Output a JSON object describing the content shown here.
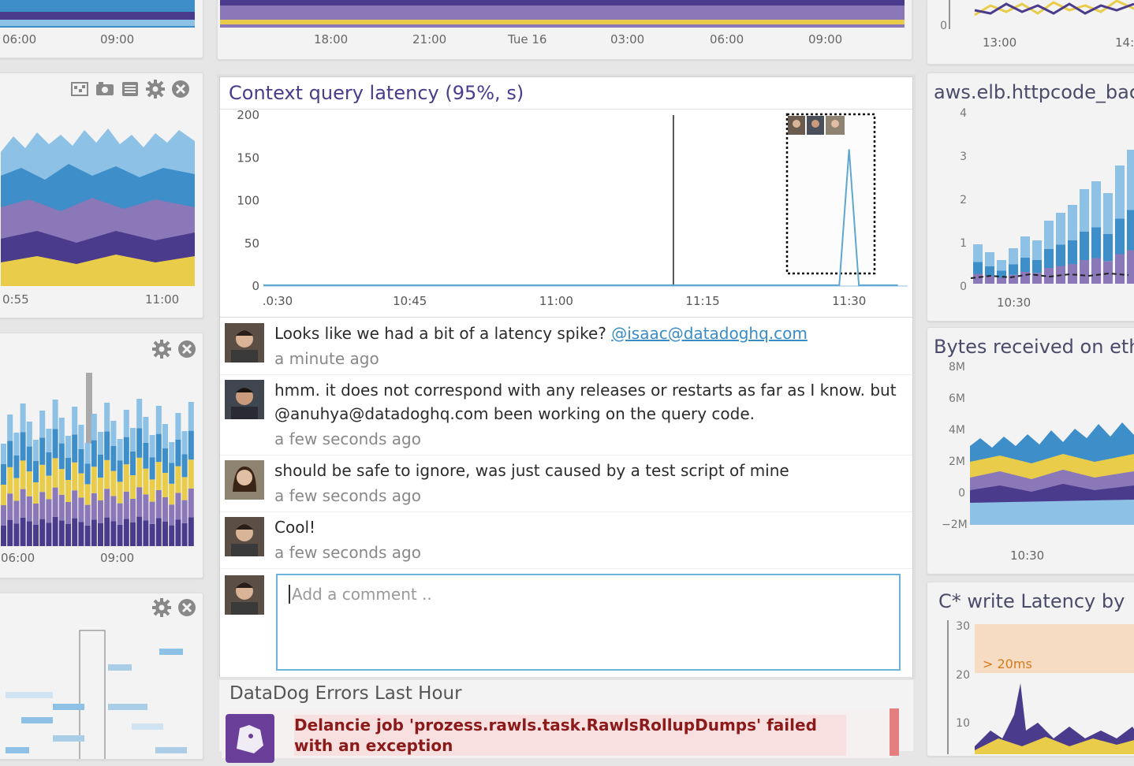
{
  "colors": {
    "purple": "#4b3b8c",
    "blue": "#3d8ec9",
    "light_blue": "#8ec1e6",
    "yellow": "#e9cd4a",
    "lavender": "#8a78b8",
    "line": "#5fa7cf",
    "link": "#3a8cc6",
    "error_red": "#8b1a1a"
  },
  "background_tiles": {
    "top_left": {
      "x_ticks": [
        "06:00",
        "09:00"
      ]
    },
    "top_center": {
      "x_ticks": [
        "18:00",
        "21:00",
        "Tue 16",
        "03:00",
        "06:00",
        "09:00"
      ]
    },
    "top_right": {
      "y_ticks": [
        "0"
      ],
      "x_ticks": [
        "13:00",
        "14:"
      ]
    },
    "left_1": {
      "x_ticks": [
        "0:55",
        "11:00"
      ],
      "icons": [
        "map-icon",
        "camera-icon",
        "list-icon",
        "gear-icon",
        "close-icon"
      ]
    },
    "left_2": {
      "x_ticks": [
        "06:00",
        "09:00"
      ],
      "icons": [
        "gear-icon",
        "close-icon"
      ]
    },
    "left_3": {
      "icons": [
        "gear-icon",
        "close-icon"
      ]
    },
    "right_1": {
      "title": "aws.elb.httpcode_bac",
      "y_ticks": [
        "4",
        "3",
        "2",
        "1",
        "0"
      ],
      "x_ticks": [
        "10:30"
      ]
    },
    "right_2": {
      "title": "Bytes received on eth",
      "y_ticks": [
        "8M",
        "6M",
        "4M",
        "2M",
        "0",
        "−2M"
      ],
      "x_ticks": [
        "10:30"
      ]
    },
    "right_3": {
      "title": "C* write Latency by",
      "y_ticks": [
        "30",
        "20",
        "10"
      ],
      "threshold_label": "> 20ms"
    }
  },
  "focus": {
    "title": "Context query latency (95%, s)",
    "chart_data": {
      "type": "line",
      "title": "Context query latency (95%, s)",
      "y_ticks": [
        "200",
        "150",
        "100",
        "50",
        "0"
      ],
      "x_ticks": [
        ".0:30",
        "10:45",
        "11:00",
        "11:15",
        "11:30"
      ],
      "ylim": [
        0,
        200
      ],
      "x": [
        "10:30",
        "10:45",
        "11:00",
        "11:10",
        "11:15",
        "11:28",
        "11:29",
        "11:30",
        "11:31",
        "11:35"
      ],
      "series": [
        {
          "values": [
            1,
            1,
            1,
            1,
            1,
            1,
            1,
            160,
            1,
            1
          ]
        }
      ],
      "event_marker_x": "11:12",
      "grid": false
    },
    "comments": [
      {
        "text": "Looks like we had a bit of a latency spike?",
        "mention": "@isaac@datadoghq.com",
        "time": "a minute ago"
      },
      {
        "text": "hmm. it does not correspond with any releases or restarts as far as I know. but @anuhya@datadoghq.com been working on the query code.",
        "time": "a few seconds ago"
      },
      {
        "text": "should be safe to ignore, was just caused by a test script of mine",
        "time": "a few seconds ago"
      },
      {
        "text": "Cool!",
        "time": "a few seconds ago"
      }
    ],
    "comment_placeholder": "Add a comment .."
  },
  "errors": {
    "title": "DataDog Errors Last Hour",
    "item": "Delancie job 'prozess.rawls.task.RawlsRollupDumps' failed with an exception"
  }
}
